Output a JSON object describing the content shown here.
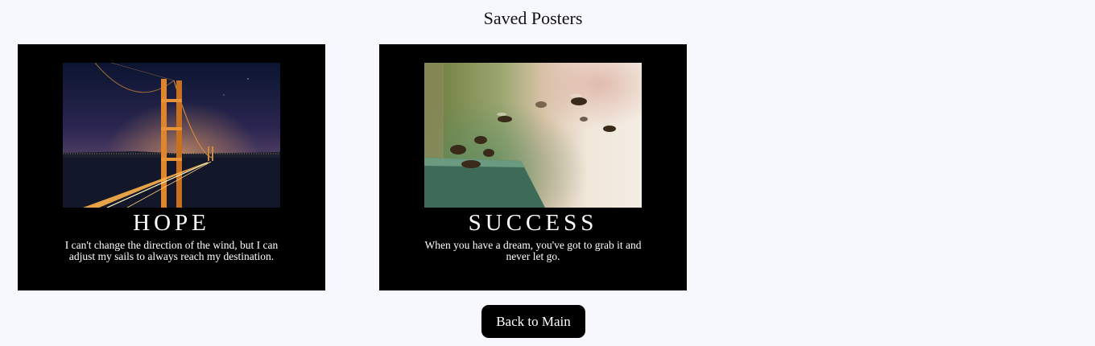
{
  "page": {
    "title": "Saved Posters"
  },
  "posters": [
    {
      "title": "HOPE",
      "quote": "I can't change the direction of the wind, but I can adjust my sails to always reach my destination.",
      "image": "golden-gate-bridge-night"
    },
    {
      "title": "SUCCESS",
      "quote": "When you have a dream, you've got to grab it and never let go.",
      "image": "bees-near-hive"
    }
  ],
  "actions": {
    "back_label": "Back to Main"
  },
  "colors": {
    "background": "#f7f7fe",
    "poster_background": "#000000",
    "poster_text": "#ffffff",
    "button_background": "#000000",
    "button_text": "#ffffff"
  }
}
